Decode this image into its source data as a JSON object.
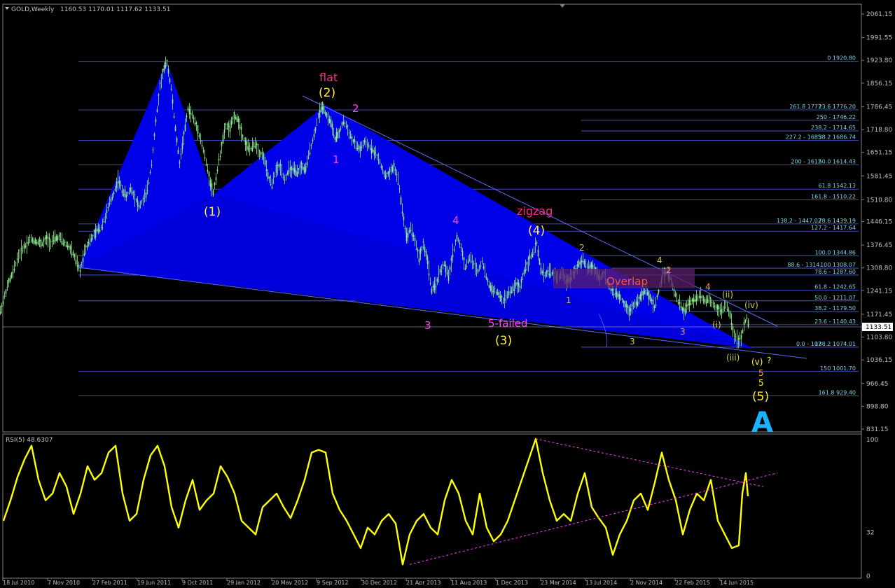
{
  "header": {
    "symbol": "GOLD,Weekly",
    "ohlc": "1160.53 1170.01 1117.62 1133.51"
  },
  "colors": {
    "background": "#000000",
    "candle": "#90ee90",
    "fibline": "#4f5ff0",
    "fibtext": "#7bd3e6",
    "wedge": "#0000e8",
    "overlap": "#5a1e6b",
    "rsi": "#ffff00",
    "magenta": "#ff40ff",
    "yellowLabel": "#ffee33",
    "orangeLabel": "#ff9b3d",
    "olive": "#c8c850",
    "cyanA": "#19b4ff",
    "axisText": "#c0c0c0"
  },
  "chart_data": [
    {
      "type": "candlestick",
      "title": "GOLD,Weekly",
      "current_price": "1133.51",
      "y_ticks": [
        "2061.15",
        "1991.55",
        "1923.80",
        "1856.15",
        "1786.45",
        "1718.80",
        "1651.15",
        "1581.45",
        "1510.80",
        "1446.15",
        "1376.45",
        "1308.80",
        "1241.15",
        "1171.45",
        "1103.80",
        "1036.15",
        "966.45",
        "898.80",
        "831.15"
      ],
      "x_ticks": [
        "18 Jul 2010",
        "7 Nov 2010",
        "27 Feb 2011",
        "19 Jun 2011",
        "9 Oct 2011",
        "29 Jan 2012",
        "20 May 2012",
        "9 Sep 2012",
        "30 Dec 2012",
        "21 Apr 2013",
        "11 Aug 2013",
        "1 Dec 2013",
        "23 Mar 2014",
        "13 Jul 2014",
        "2 Nov 2014",
        "22 Feb 2015",
        "14 Jun 2015"
      ],
      "price_path": [
        [
          0,
          1180
        ],
        [
          6,
          1225
        ],
        [
          12,
          1265
        ],
        [
          18,
          1295
        ],
        [
          24,
          1335
        ],
        [
          30,
          1360
        ],
        [
          36,
          1375
        ],
        [
          42,
          1395
        ],
        [
          48,
          1390
        ],
        [
          54,
          1385
        ],
        [
          60,
          1380
        ],
        [
          66,
          1395
        ],
        [
          72,
          1385
        ],
        [
          78,
          1395
        ],
        [
          84,
          1400
        ],
        [
          90,
          1385
        ],
        [
          96,
          1375
        ],
        [
          102,
          1360
        ],
        [
          108,
          1330
        ],
        [
          114,
          1300
        ],
        [
          120,
          1360
        ],
        [
          126,
          1385
        ],
        [
          132,
          1400
        ],
        [
          138,
          1420
        ],
        [
          144,
          1430
        ],
        [
          150,
          1460
        ],
        [
          156,
          1500
        ],
        [
          162,
          1530
        ],
        [
          168,
          1570
        ],
        [
          174,
          1540
        ],
        [
          180,
          1520
        ],
        [
          186,
          1545
        ],
        [
          192,
          1520
        ],
        [
          198,
          1490
        ],
        [
          204,
          1510
        ],
        [
          210,
          1540
        ],
        [
          216,
          1620
        ],
        [
          222,
          1740
        ],
        [
          228,
          1850
        ],
        [
          234,
          1900
        ],
        [
          238,
          1920
        ],
        [
          244,
          1840
        ],
        [
          250,
          1720
        ],
        [
          256,
          1620
        ],
        [
          262,
          1700
        ],
        [
          268,
          1780
        ],
        [
          274,
          1760
        ],
        [
          280,
          1730
        ],
        [
          286,
          1690
        ],
        [
          292,
          1640
        ],
        [
          298,
          1580
        ],
        [
          304,
          1530
        ],
        [
          310,
          1600
        ],
        [
          316,
          1670
        ],
        [
          322,
          1730
        ],
        [
          328,
          1720
        ],
        [
          334,
          1760
        ],
        [
          340,
          1745
        ],
        [
          346,
          1700
        ],
        [
          352,
          1670
        ],
        [
          358,
          1660
        ],
        [
          364,
          1680
        ],
        [
          370,
          1650
        ],
        [
          376,
          1640
        ],
        [
          382,
          1580
        ],
        [
          388,
          1555
        ],
        [
          394,
          1600
        ],
        [
          400,
          1610
        ],
        [
          406,
          1570
        ],
        [
          412,
          1600
        ],
        [
          418,
          1600
        ],
        [
          424,
          1590
        ],
        [
          430,
          1610
        ],
        [
          436,
          1600
        ],
        [
          442,
          1660
        ],
        [
          448,
          1700
        ],
        [
          454,
          1760
        ],
        [
          460,
          1790
        ],
        [
          466,
          1760
        ],
        [
          472,
          1740
        ],
        [
          478,
          1690
        ],
        [
          484,
          1710
        ],
        [
          490,
          1745
        ],
        [
          496,
          1720
        ],
        [
          502,
          1690
        ],
        [
          508,
          1670
        ],
        [
          514,
          1660
        ],
        [
          520,
          1680
        ],
        [
          526,
          1670
        ],
        [
          532,
          1660
        ],
        [
          538,
          1640
        ],
        [
          544,
          1610
        ],
        [
          550,
          1580
        ],
        [
          556,
          1590
        ],
        [
          562,
          1610
        ],
        [
          568,
          1570
        ],
        [
          574,
          1480
        ],
        [
          580,
          1400
        ],
        [
          586,
          1430
        ],
        [
          592,
          1390
        ],
        [
          598,
          1340
        ],
        [
          604,
          1380
        ],
        [
          610,
          1330
        ],
        [
          616,
          1240
        ],
        [
          622,
          1260
        ],
        [
          628,
          1300
        ],
        [
          634,
          1320
        ],
        [
          640,
          1280
        ],
        [
          646,
          1350
        ],
        [
          652,
          1400
        ],
        [
          658,
          1370
        ],
        [
          664,
          1310
        ],
        [
          670,
          1340
        ],
        [
          676,
          1320
        ],
        [
          682,
          1300
        ],
        [
          688,
          1330
        ],
        [
          694,
          1280
        ],
        [
          700,
          1250
        ],
        [
          706,
          1240
        ],
        [
          712,
          1230
        ],
        [
          718,
          1210
        ],
        [
          724,
          1230
        ],
        [
          730,
          1240
        ],
        [
          736,
          1260
        ],
        [
          742,
          1250
        ],
        [
          748,
          1300
        ],
        [
          754,
          1330
        ],
        [
          760,
          1350
        ],
        [
          766,
          1380
        ],
        [
          772,
          1300
        ],
        [
          778,
          1290
        ],
        [
          784,
          1300
        ],
        [
          790,
          1290
        ],
        [
          796,
          1280
        ],
        [
          802,
          1290
        ],
        [
          808,
          1270
        ],
        [
          814,
          1280
        ],
        [
          820,
          1300
        ],
        [
          826,
          1320
        ],
        [
          832,
          1330
        ],
        [
          838,
          1310
        ],
        [
          844,
          1310
        ],
        [
          850,
          1300
        ],
        [
          856,
          1280
        ],
        [
          862,
          1290
        ],
        [
          868,
          1260
        ],
        [
          874,
          1240
        ],
        [
          880,
          1230
        ],
        [
          886,
          1220
        ],
        [
          892,
          1200
        ],
        [
          898,
          1180
        ],
        [
          904,
          1200
        ],
        [
          910,
          1210
        ],
        [
          916,
          1230
        ],
        [
          922,
          1240
        ],
        [
          928,
          1220
        ],
        [
          934,
          1190
        ],
        [
          940,
          1240
        ],
        [
          946,
          1290
        ],
        [
          952,
          1300
        ],
        [
          958,
          1270
        ],
        [
          964,
          1230
        ],
        [
          970,
          1200
        ],
        [
          976,
          1180
        ],
        [
          982,
          1200
        ],
        [
          988,
          1210
        ],
        [
          994,
          1220
        ],
        [
          1000,
          1230
        ],
        [
          1006,
          1210
        ],
        [
          1012,
          1220
        ],
        [
          1018,
          1200
        ],
        [
          1024,
          1190
        ],
        [
          1030,
          1180
        ],
        [
          1036,
          1200
        ],
        [
          1042,
          1170
        ],
        [
          1048,
          1110
        ],
        [
          1054,
          1090
        ],
        [
          1058,
          1100
        ],
        [
          1062,
          1140
        ],
        [
          1066,
          1160
        ],
        [
          1070,
          1133
        ]
      ]
    },
    {
      "type": "line",
      "title": "RSI(5) 48.6307",
      "y_ticks": [
        "100",
        "32",
        "0"
      ],
      "ylim": [
        0,
        100
      ],
      "rsi_path": [
        [
          5,
          40
        ],
        [
          15,
          55
        ],
        [
          25,
          72
        ],
        [
          35,
          85
        ],
        [
          45,
          95
        ],
        [
          55,
          70
        ],
        [
          65,
          55
        ],
        [
          75,
          60
        ],
        [
          85,
          75
        ],
        [
          95,
          65
        ],
        [
          105,
          45
        ],
        [
          115,
          60
        ],
        [
          125,
          80
        ],
        [
          135,
          70
        ],
        [
          145,
          75
        ],
        [
          155,
          90
        ],
        [
          165,
          95
        ],
        [
          175,
          60
        ],
        [
          185,
          40
        ],
        [
          195,
          45
        ],
        [
          205,
          70
        ],
        [
          215,
          88
        ],
        [
          225,
          95
        ],
        [
          235,
          80
        ],
        [
          245,
          50
        ],
        [
          255,
          35
        ],
        [
          265,
          55
        ],
        [
          275,
          70
        ],
        [
          285,
          48
        ],
        [
          295,
          55
        ],
        [
          305,
          60
        ],
        [
          315,
          80
        ],
        [
          325,
          72
        ],
        [
          335,
          60
        ],
        [
          345,
          40
        ],
        [
          355,
          35
        ],
        [
          365,
          30
        ],
        [
          375,
          50
        ],
        [
          385,
          55
        ],
        [
          395,
          60
        ],
        [
          405,
          50
        ],
        [
          415,
          42
        ],
        [
          425,
          55
        ],
        [
          435,
          70
        ],
        [
          445,
          90
        ],
        [
          455,
          92
        ],
        [
          465,
          90
        ],
        [
          475,
          60
        ],
        [
          485,
          48
        ],
        [
          495,
          40
        ],
        [
          505,
          30
        ],
        [
          515,
          20
        ],
        [
          525,
          35
        ],
        [
          535,
          30
        ],
        [
          545,
          40
        ],
        [
          555,
          45
        ],
        [
          565,
          38
        ],
        [
          575,
          8
        ],
        [
          585,
          30
        ],
        [
          595,
          40
        ],
        [
          605,
          45
        ],
        [
          615,
          35
        ],
        [
          625,
          30
        ],
        [
          635,
          55
        ],
        [
          645,
          70
        ],
        [
          655,
          60
        ],
        [
          665,
          40
        ],
        [
          675,
          30
        ],
        [
          685,
          60
        ],
        [
          695,
          35
        ],
        [
          705,
          25
        ],
        [
          715,
          30
        ],
        [
          725,
          40
        ],
        [
          735,
          55
        ],
        [
          745,
          70
        ],
        [
          755,
          85
        ],
        [
          765,
          100
        ],
        [
          775,
          75
        ],
        [
          785,
          55
        ],
        [
          795,
          40
        ],
        [
          805,
          45
        ],
        [
          815,
          40
        ],
        [
          825,
          60
        ],
        [
          835,
          75
        ],
        [
          845,
          50
        ],
        [
          855,
          42
        ],
        [
          865,
          35
        ],
        [
          875,
          15
        ],
        [
          885,
          30
        ],
        [
          895,
          40
        ],
        [
          905,
          55
        ],
        [
          915,
          60
        ],
        [
          925,
          48
        ],
        [
          935,
          68
        ],
        [
          945,
          90
        ],
        [
          955,
          70
        ],
        [
          965,
          55
        ],
        [
          975,
          30
        ],
        [
          985,
          48
        ],
        [
          995,
          60
        ],
        [
          1005,
          55
        ],
        [
          1015,
          70
        ],
        [
          1025,
          40
        ],
        [
          1035,
          30
        ],
        [
          1045,
          20
        ],
        [
          1055,
          22
        ],
        [
          1060,
          60
        ],
        [
          1065,
          75
        ],
        [
          1068,
          58
        ]
      ]
    }
  ],
  "fib_levels": [
    {
      "label": "0 1920.80",
      "price": 1920.8
    },
    {
      "label": "261.8 1777",
      "label2": "23.6 1776.20",
      "price": 1777
    },
    {
      "label": "250 - 1746.22",
      "price": 1746.22
    },
    {
      "label": "238.2 - 1714.65",
      "price": 1714.65
    },
    {
      "label": "227.2 - 1685",
      "label2": "38.2 1686.74",
      "price": 1686.74
    },
    {
      "label": "200 - 1612",
      "label2": "50.0 1614.43",
      "price": 1614.43
    },
    {
      "label": "61.8 1542.13",
      "price": 1542.13
    },
    {
      "label": "161.8 - 1510.22",
      "price": 1510.22
    },
    {
      "label": "138.2 - 1447.02",
      "label2": "78.6 1439.19",
      "price": 1439.19
    },
    {
      "label": "127.2 - 1417.64",
      "price": 1417.64
    },
    {
      "label": "100.0 1344.86",
      "price": 1344.86
    },
    {
      "label": "88.6 - 1314.",
      "label2": "100 1308.07",
      "price": 1308.07
    },
    {
      "label": "78.6 - 1287.60",
      "price": 1287.6
    },
    {
      "label": "61.8 - 1242.65",
      "price": 1242.65
    },
    {
      "label": "50.0 - 1211.07",
      "price": 1211.07
    },
    {
      "label": "38.2 - 1179.50",
      "price": 1179.5
    },
    {
      "label": "23.6 - 1140.43",
      "price": 1140.43
    },
    {
      "label": "0.0 - 107",
      "label2": "138.2 1074.01",
      "price": 1074.01
    },
    {
      "label": "150 1001.70",
      "price": 1001.7
    },
    {
      "label": "161.8 929.40",
      "price": 929.4
    }
  ],
  "annotations": {
    "flat": "flat",
    "w2": "(2)",
    "w1": "(1)",
    "w3": "(3)",
    "w4": "(4)",
    "w5": "(5)",
    "zigzag": "zigzag",
    "fivefailed": "5-failed",
    "overlap": "Overlap",
    "m1": "1",
    "m2": "2",
    "m3": "3",
    "m4": "4",
    "s1": "1",
    "s2": "2",
    "s3": "3",
    "s4": "4",
    "o2": "2",
    "o3": "3",
    "o4": "4",
    "o5": "5",
    "r_i": "(i)",
    "r_ii": "(ii)",
    "r_iii": "(iii)",
    "r_iv": "(iv)",
    "r_v": "(v)",
    "q": "?",
    "y5": "5",
    "bigA": "A"
  }
}
